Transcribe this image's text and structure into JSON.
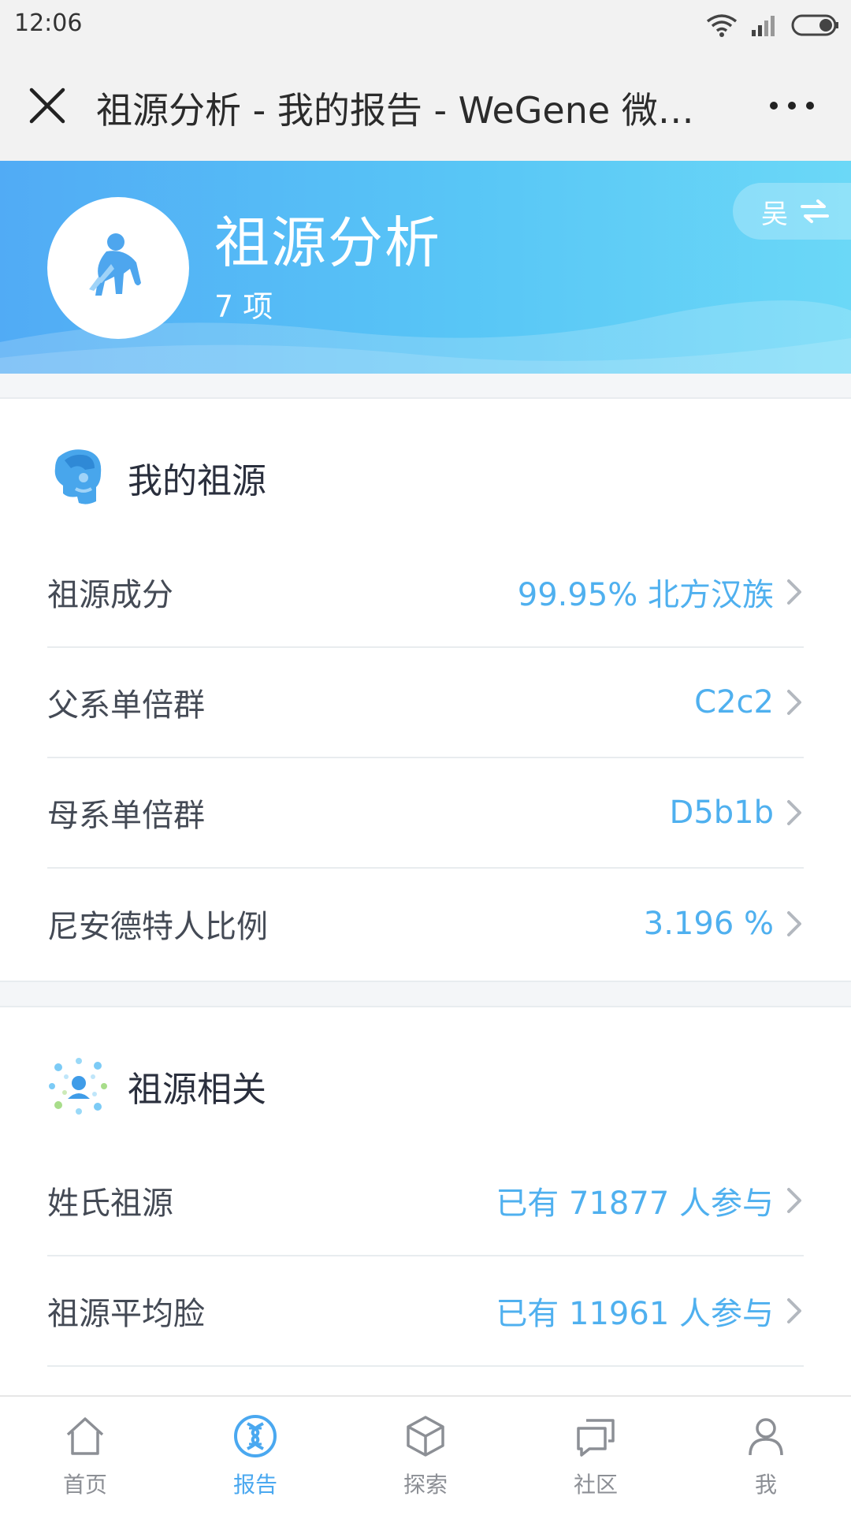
{
  "status_bar": {
    "time": "12:06"
  },
  "title_bar": {
    "title": "祖源分析 - 我的报告 - WeGene 微…"
  },
  "banner": {
    "title": "祖源分析",
    "count": "7 项",
    "profile_switch_label": "吴"
  },
  "my_ancestry": {
    "title": "我的祖源",
    "rows": [
      {
        "label": "祖源成分",
        "value": "99.95% 北方汉族"
      },
      {
        "label": "父系单倍群",
        "value": "C2c2"
      },
      {
        "label": "母系单倍群",
        "value": "D5b1b"
      },
      {
        "label": "尼安德特人比例",
        "value": "3.196 %"
      }
    ]
  },
  "ancestry_related": {
    "title": "祖源相关",
    "rows": [
      {
        "label": "姓氏祖源",
        "value": "已有 71877 人参与"
      },
      {
        "label": "祖源平均脸",
        "value": "已有 11961 人参与"
      }
    ]
  },
  "bottom_nav": [
    {
      "label": "首页",
      "icon": "home-icon"
    },
    {
      "label": "报告",
      "icon": "dna-icon",
      "active": true
    },
    {
      "label": "探索",
      "icon": "cube-icon"
    },
    {
      "label": "社区",
      "icon": "chat-icon"
    },
    {
      "label": "我",
      "icon": "user-icon"
    }
  ],
  "colors": {
    "accent": "#4fb0ef",
    "banner_start": "#51abf5",
    "banner_end": "#6bd8f7"
  }
}
